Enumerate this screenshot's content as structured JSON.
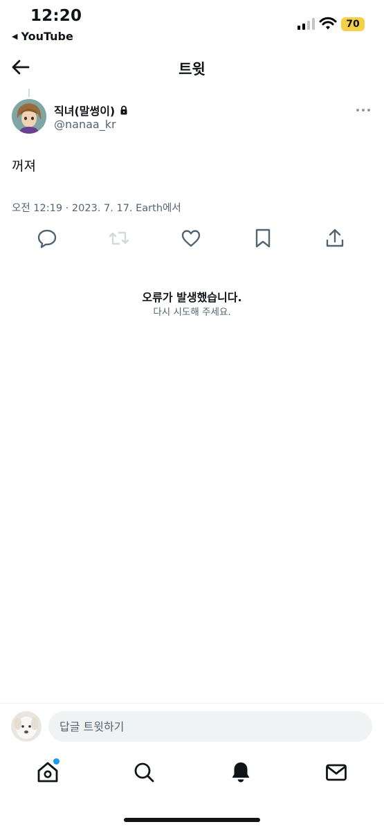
{
  "status_bar": {
    "time": "12:20",
    "back_app": "YouTube",
    "battery": "70"
  },
  "header": {
    "title": "트윗"
  },
  "tweet": {
    "display_name": "직녀(말썽이)",
    "handle": "@nanaa_kr",
    "text": "꺼져",
    "meta": "오전 12:19 · 2023. 7. 17. Earth에서"
  },
  "error": {
    "title": "오류가 발생했습니다.",
    "subtitle": "다시 시도해 주세요."
  },
  "reply": {
    "placeholder": "답글 트윗하기"
  },
  "icons": {
    "actions": [
      "reply-icon",
      "retweet-icon",
      "like-icon",
      "bookmark-icon",
      "share-icon"
    ],
    "tabs": [
      "home-icon",
      "search-icon",
      "notifications-icon",
      "messages-icon"
    ]
  },
  "colors": {
    "accent": "#1d9bf0",
    "muted": "#536471",
    "battery": "#f5d146"
  }
}
